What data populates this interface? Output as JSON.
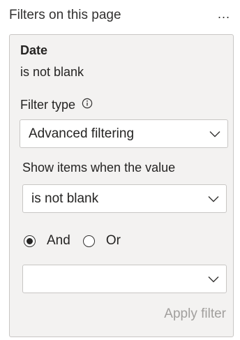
{
  "header": {
    "title": "Filters on this page",
    "more_label": "..."
  },
  "filter_card": {
    "field_name": "Date",
    "summary": "is not blank",
    "filter_type_label": "Filter type",
    "filter_type_value": "Advanced filtering",
    "show_items_label": "Show items when the value",
    "condition_value": "is not blank",
    "logic": {
      "and_label": "And",
      "or_label": "Or",
      "selected": "And"
    },
    "second_condition_value": "",
    "apply_label": "Apply filter"
  },
  "icons": {
    "info": "info-icon",
    "chevron": "chevron-down-icon"
  },
  "colors": {
    "card_background": "#f3f2f1",
    "disabled_text": "#a19f9d"
  }
}
